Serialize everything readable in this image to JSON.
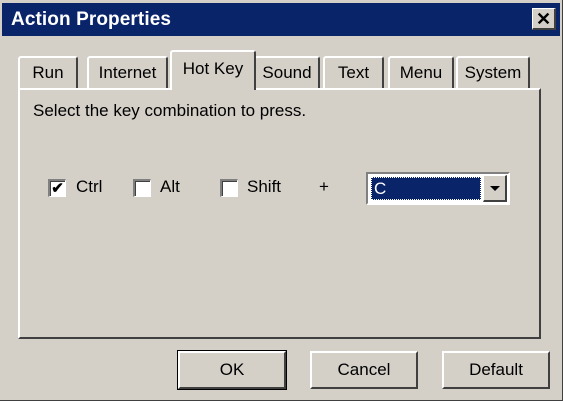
{
  "window": {
    "title": "Action Properties"
  },
  "tabs": [
    {
      "label": "Run"
    },
    {
      "label": "Internet"
    },
    {
      "label": "Hot Key"
    },
    {
      "label": "Sound"
    },
    {
      "label": "Text"
    },
    {
      "label": "Menu"
    },
    {
      "label": "System"
    }
  ],
  "active_tab": "Hot Key",
  "hotkey": {
    "instruction": "Select the key combination to press.",
    "ctrl": {
      "label": "Ctrl",
      "checked": true
    },
    "alt": {
      "label": "Alt",
      "checked": false
    },
    "shift": {
      "label": "Shift",
      "checked": false
    },
    "plus": "+",
    "key_value": "C"
  },
  "buttons": {
    "ok": "OK",
    "cancel": "Cancel",
    "default": "Default"
  },
  "icons": {
    "close": "close-icon",
    "check": "checkmark-icon",
    "dropdown": "chevron-down-icon"
  },
  "colors": {
    "titlebar": "#0a246a",
    "face": "#d4d0c8",
    "selection": "#0a246a"
  }
}
